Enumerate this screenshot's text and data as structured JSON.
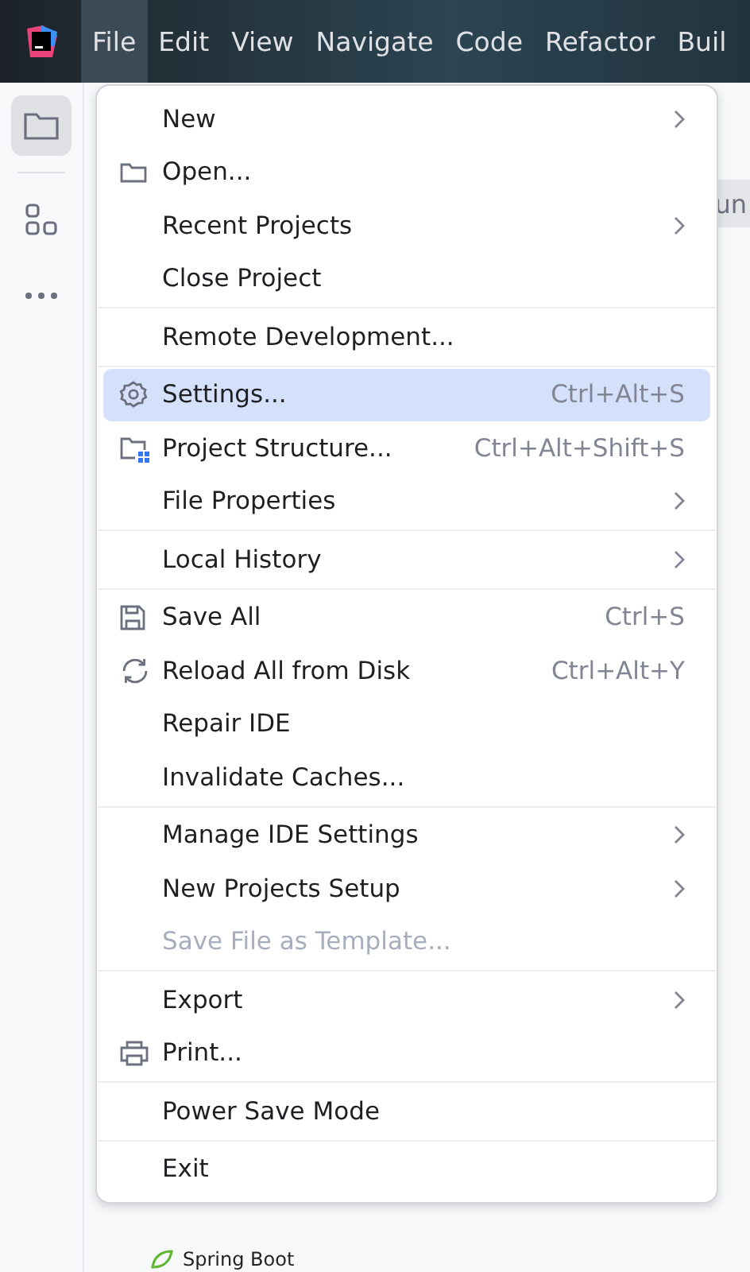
{
  "menu_bar": [
    {
      "label": "File",
      "selected": true
    },
    {
      "label": "Edit",
      "selected": false
    },
    {
      "label": "View",
      "selected": false
    },
    {
      "label": "Navigate",
      "selected": false
    },
    {
      "label": "Code",
      "selected": false
    },
    {
      "label": "Refactor",
      "selected": false
    },
    {
      "label": "Buil",
      "selected": false
    }
  ],
  "sidebar": [
    {
      "kind": "folder",
      "selected": true
    },
    {
      "kind": "structure",
      "selected": false
    },
    {
      "kind": "more",
      "selected": false
    }
  ],
  "editor_tab": {
    "label": "un"
  },
  "tree_row": {
    "label": "Spring Boot"
  },
  "file_menu": [
    [
      {
        "label": "New",
        "kind": "plain",
        "has_submenu": true,
        "selected": false,
        "disabled": false
      },
      {
        "label": "Open...",
        "kind": "folder",
        "has_submenu": false,
        "selected": false,
        "disabled": false
      },
      {
        "label": "Recent Projects",
        "kind": "plain",
        "has_submenu": true,
        "selected": false,
        "disabled": false
      },
      {
        "label": "Close Project",
        "kind": "plain",
        "has_submenu": false,
        "selected": false,
        "disabled": false
      }
    ],
    [
      {
        "label": "Remote Development...",
        "kind": "plain",
        "has_submenu": false,
        "selected": false,
        "disabled": false
      }
    ],
    [
      {
        "label": "Settings...",
        "kind": "gear",
        "shortcut": "Ctrl+Alt+S",
        "has_submenu": false,
        "selected": true,
        "disabled": false
      },
      {
        "label": "Project Structure...",
        "kind": "structure",
        "shortcut": "Ctrl+Alt+Shift+S",
        "has_submenu": false,
        "selected": false,
        "disabled": false
      },
      {
        "label": "File Properties",
        "kind": "plain",
        "has_submenu": true,
        "selected": false,
        "disabled": false
      }
    ],
    [
      {
        "label": "Local History",
        "kind": "plain",
        "has_submenu": true,
        "selected": false,
        "disabled": false
      }
    ],
    [
      {
        "label": "Save All",
        "kind": "save",
        "shortcut": "Ctrl+S",
        "has_submenu": false,
        "selected": false,
        "disabled": false
      },
      {
        "label": "Reload All from Disk",
        "kind": "reload",
        "shortcut": "Ctrl+Alt+Y",
        "has_submenu": false,
        "selected": false,
        "disabled": false
      },
      {
        "label": "Repair IDE",
        "kind": "plain",
        "has_submenu": false,
        "selected": false,
        "disabled": false
      },
      {
        "label": "Invalidate Caches...",
        "kind": "plain",
        "has_submenu": false,
        "selected": false,
        "disabled": false
      }
    ],
    [
      {
        "label": "Manage IDE Settings",
        "kind": "plain",
        "has_submenu": true,
        "selected": false,
        "disabled": false
      },
      {
        "label": "New Projects Setup",
        "kind": "plain",
        "has_submenu": true,
        "selected": false,
        "disabled": false
      },
      {
        "label": "Save File as Template...",
        "kind": "plain",
        "has_submenu": false,
        "selected": false,
        "disabled": true
      }
    ],
    [
      {
        "label": "Export",
        "kind": "plain",
        "has_submenu": true,
        "selected": false,
        "disabled": false
      },
      {
        "label": "Print...",
        "kind": "print",
        "has_submenu": false,
        "selected": false,
        "disabled": false
      }
    ],
    [
      {
        "label": "Power Save Mode",
        "kind": "plain",
        "has_submenu": false,
        "selected": false,
        "disabled": false
      }
    ],
    [
      {
        "label": "Exit",
        "kind": "plain",
        "has_submenu": false,
        "selected": false,
        "disabled": false
      }
    ]
  ]
}
